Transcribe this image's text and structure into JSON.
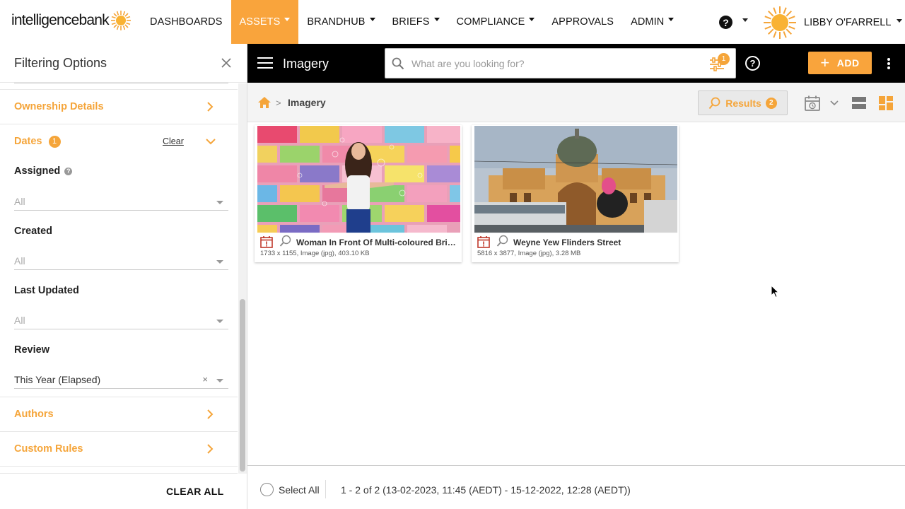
{
  "brand": {
    "logo_text": "intelligencebank",
    "accent": "#f9a43c"
  },
  "topnav": {
    "items": [
      {
        "label": "DASHBOARDS",
        "dropdown": false,
        "active": false
      },
      {
        "label": "ASSETS",
        "dropdown": true,
        "active": true
      },
      {
        "label": "BRANDHUB",
        "dropdown": true,
        "active": false
      },
      {
        "label": "BRIEFS",
        "dropdown": true,
        "active": false
      },
      {
        "label": "COMPLIANCE",
        "dropdown": true,
        "active": false
      },
      {
        "label": "APPROVALS",
        "dropdown": false,
        "active": false
      },
      {
        "label": "ADMIN",
        "dropdown": true,
        "active": false
      }
    ],
    "help_symbol": "?",
    "user_name": "LIBBY O'FARRELL"
  },
  "sidebar": {
    "title": "Filtering Options",
    "sections": {
      "ownership": {
        "label": "Ownership Details"
      },
      "dates": {
        "label": "Dates",
        "badge": "1",
        "clear_label": "Clear"
      },
      "authors": {
        "label": "Authors"
      },
      "custom_rules": {
        "label": "Custom Rules"
      }
    },
    "fields": {
      "assigned": {
        "label": "Assigned",
        "value": "All"
      },
      "created": {
        "label": "Created",
        "value": "All"
      },
      "last_updated": {
        "label": "Last Updated",
        "value": "All"
      },
      "review": {
        "label": "Review",
        "value": "This Year (Elapsed)",
        "clear_symbol": "×"
      }
    },
    "clear_all_label": "CLEAR ALL"
  },
  "toolbar": {
    "page_label": "Imagery",
    "search_placeholder": "What are you looking for?",
    "filter_badge": "1",
    "add_label": "ADD",
    "add_symbol": "+"
  },
  "breadcrumb": {
    "separator": ">",
    "current": "Imagery",
    "results_label": "Results",
    "results_count": "2"
  },
  "assets": [
    {
      "title": "Woman In Front Of Multi-coloured Bricks",
      "meta": "1733 x 1155, Image (jpg), 403.10 KB"
    },
    {
      "title": "Weyne Yew Flinders Street",
      "meta": "5816 x 3877, Image (jpg), 3.28 MB"
    }
  ],
  "footer": {
    "select_all_label": "Select All",
    "range_text": "1 - 2 of 2 (13-02-2023, 11:45 (AEDT) - 15-12-2022, 12:28 (AEDT))"
  }
}
